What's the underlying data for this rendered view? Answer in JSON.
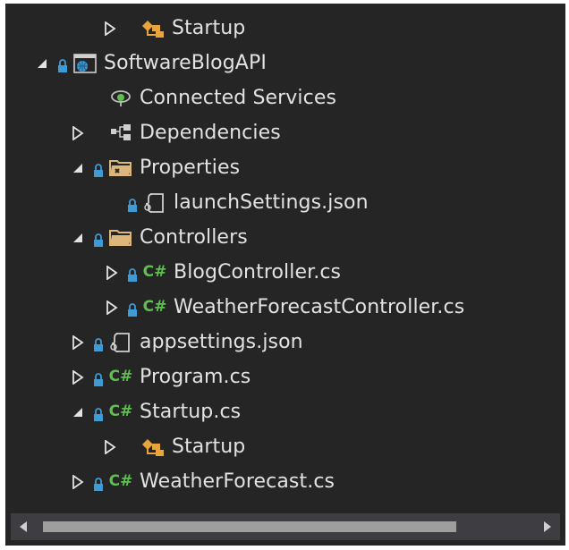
{
  "solution_explorer": {
    "items": [
      {
        "label": "Startup",
        "icon": "class-icon",
        "expander": "collapsed",
        "locked": false
      },
      {
        "label": "SoftwareBlogAPI",
        "icon": "web-project-icon",
        "expander": "expanded",
        "locked": true
      },
      {
        "label": "Connected Services",
        "icon": "connected-services-icon",
        "expander": "none",
        "locked": false
      },
      {
        "label": "Dependencies",
        "icon": "dependencies-icon",
        "expander": "collapsed",
        "locked": false
      },
      {
        "label": "Properties",
        "icon": "properties-folder-icon",
        "expander": "expanded",
        "locked": true
      },
      {
        "label": "launchSettings.json",
        "icon": "json-file-icon",
        "expander": "none",
        "locked": true
      },
      {
        "label": "Controllers",
        "icon": "folder-icon",
        "expander": "expanded",
        "locked": true
      },
      {
        "label": "BlogController.cs",
        "icon": "csharp-file-icon",
        "expander": "collapsed",
        "locked": true
      },
      {
        "label": "WeatherForecastController.cs",
        "icon": "csharp-file-icon",
        "expander": "collapsed",
        "locked": true
      },
      {
        "label": "appsettings.json",
        "icon": "json-file-icon",
        "expander": "collapsed",
        "locked": true
      },
      {
        "label": "Program.cs",
        "icon": "csharp-file-icon",
        "expander": "collapsed",
        "locked": true
      },
      {
        "label": "Startup.cs",
        "icon": "csharp-file-icon",
        "expander": "expanded",
        "locked": true
      },
      {
        "label": "Startup",
        "icon": "class-icon",
        "expander": "collapsed",
        "locked": false
      },
      {
        "label": "WeatherForecast.cs",
        "icon": "csharp-file-icon",
        "expander": "collapsed",
        "locked": true
      }
    ],
    "csharp_badge": "C#"
  },
  "colors": {
    "background": "#252526",
    "text": "#e2e2e2",
    "lock": "#3e9bd6",
    "folder": "#dcb67a",
    "csharp": "#5fbf4f",
    "class": "#e8a53e",
    "scrollbar_track": "#3e3e42",
    "scrollbar_thumb": "#9e9e9e"
  }
}
